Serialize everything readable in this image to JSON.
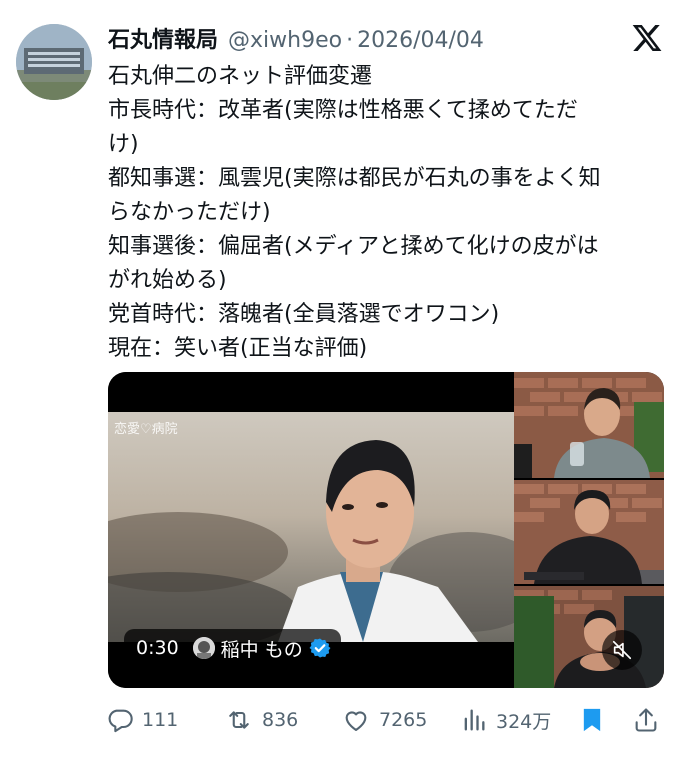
{
  "tweet": {
    "author_name": "石丸情報局",
    "handle": "@xiwh9eo",
    "separator": "·",
    "date": "2026/04/04",
    "lines": [
      "石丸伸二のネット評価変遷",
      "市長時代：改革者(実際は性格悪くて揉めてただ",
      "け)",
      "都知事選：風雲児(実際は都民が石丸の事をよく知",
      "らなかっただけ)",
      "知事選後：偏屈者(メディアと揉めて化けの皮がは",
      "がれ始める)",
      "党首時代：落魄者(全員落選でオワコン)",
      "現在：笑い者(正当な評価)"
    ]
  },
  "video": {
    "watermark": "恋愛♡病院",
    "time": "0:30",
    "channel_name": "稲中 もの",
    "verified_color": "#1d9bf0"
  },
  "actions": {
    "replies": "111",
    "reposts": "836",
    "likes": "7265",
    "views": "324万"
  },
  "colors": {
    "text": "#0f1419",
    "secondary": "#536471",
    "bookmark_active": "#1d9bf0"
  },
  "icons": [
    "x-logo-icon",
    "reply-icon",
    "repost-icon",
    "like-icon",
    "views-icon",
    "bookmark-icon",
    "share-icon",
    "mute-icon",
    "verified-badge-icon"
  ]
}
